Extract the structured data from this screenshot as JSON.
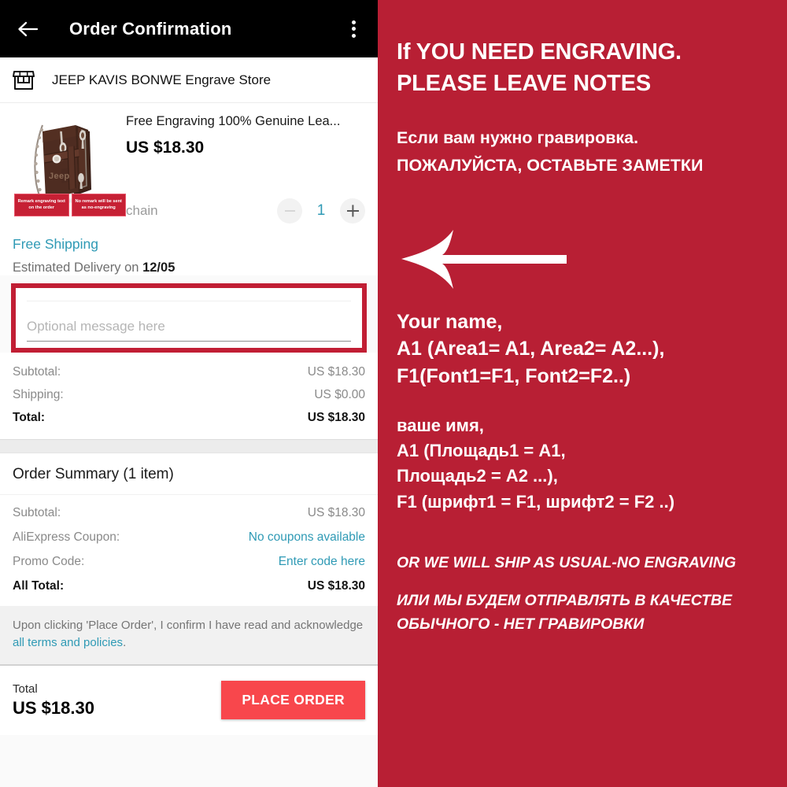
{
  "appbar": {
    "title": "Order Confirmation",
    "back_icon": "arrow-left-icon",
    "overflow_icon": "more-vertical-icon"
  },
  "store": {
    "icon": "storefront-icon",
    "name": "JEEP KAVIS BONWE Engrave Store"
  },
  "product": {
    "title": "Free Engraving 100% Genuine Lea...",
    "price": "US $18.30",
    "variant": "chain",
    "quantity": "1",
    "decrease_label": "−",
    "increase_label": "+",
    "image_badges": [
      "Remark engraving text on the order",
      "No remark will be sent as no-engraving"
    ]
  },
  "shipping": {
    "free_shipping": "Free Shipping",
    "eta_prefix": "Estimated Delivery on ",
    "eta_date": "12/05"
  },
  "message_box": {
    "placeholder": "Optional message here",
    "value": ""
  },
  "totals": {
    "rows": [
      {
        "label": "Subtotal:",
        "value": "US $18.30"
      },
      {
        "label": "Shipping:",
        "value": "US $0.00"
      },
      {
        "label": "Total:",
        "value": "US $18.30"
      }
    ]
  },
  "order_summary": {
    "heading": "Order Summary (1 item)",
    "rows": [
      {
        "label": "Subtotal:",
        "value": "US $18.30"
      },
      {
        "label": "AliExpress Coupon:",
        "value": "No coupons available"
      },
      {
        "label": "Promo Code:",
        "value": "Enter code here"
      },
      {
        "label": "All Total:",
        "value": "US $18.30"
      }
    ]
  },
  "terms": {
    "text_before": "Upon clicking 'Place Order', I confirm I have read and acknowledge ",
    "link": "all terms and policies",
    "text_after": "."
  },
  "footer": {
    "total_label": "Total",
    "total_value": "US $18.30",
    "place_order_label": "PLACE ORDER"
  },
  "panel": {
    "headline_line1": "If YOU NEED ENGRAVING.",
    "headline_line2": "PLEASE LEAVE NOTES",
    "ru_line1": "Если вам нужно гравировка.",
    "ru_line2": "ПОЖАЛУЙСТА, ОСТАВЬТЕ ЗАМЕТКИ",
    "arrow_icon": "arrow-left-pointer-icon",
    "eng_line1": "Your name,",
    "eng_line2": "A1  (Area1= A1, Area2= A2...),",
    "eng_line3": "F1(Font1=F1, Font2=F2..)",
    "ru2_line1": "ваше имя,",
    "ru2_line2": "A1 (Площадь1 = A1,",
    "ru2_line3": "Площадь2 = A2 ...),",
    "ru2_line4": "F1 (шрифт1 = F1, шрифт2 = F2 ..)",
    "foot_en": "OR WE WILL SHIP AS USUAL-NO ENGRAVING",
    "foot_ru_line1": "ИЛИ МЫ БУДЕМ ОТПРАВЛЯТЬ В КАЧЕСТВЕ",
    "foot_ru_line2": "ОБЫЧНОГО - НЕТ ГРАВИРОВКИ"
  },
  "colors": {
    "panel_red": "#b81f34",
    "highlight_red": "#c11e34",
    "cta_red": "#f8474c",
    "link_teal": "#2f9ab5",
    "appbar_black": "#000000"
  }
}
